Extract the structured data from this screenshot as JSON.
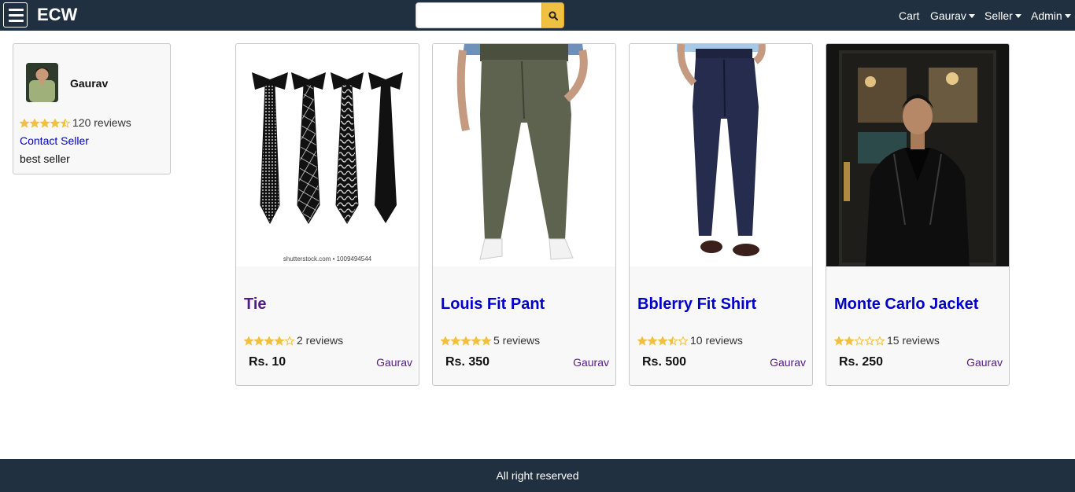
{
  "header": {
    "brand": "ECW",
    "search": {
      "value": "",
      "placeholder": ""
    },
    "nav": {
      "cart": "Cart",
      "user": "Gaurav",
      "seller": "Seller",
      "admin": "Admin"
    }
  },
  "seller": {
    "name": "Gaurav",
    "rating": 4.5,
    "reviews_text": "120 reviews",
    "contact_label": "Contact Seller",
    "description": "best seller"
  },
  "products": [
    {
      "name": "Tie",
      "rating": 4,
      "reviews_text": "2 reviews",
      "price": "Rs. 10",
      "seller": "Gaurav",
      "image": "tie-image",
      "watermark": "shutterstock.com • 1009494544"
    },
    {
      "name": "Louis Fit Pant",
      "rating": 5,
      "reviews_text": "5 reviews",
      "price": "Rs. 350",
      "seller": "Gaurav",
      "image": "olive-pant-image"
    },
    {
      "name": "Bblerry Fit Shirt",
      "rating": 3.5,
      "reviews_text": "10 reviews",
      "price": "Rs. 500",
      "seller": "Gaurav",
      "image": "navy-pant-image"
    },
    {
      "name": "Monte Carlo Jacket",
      "rating": 2,
      "reviews_text": "15 reviews",
      "price": "Rs. 250",
      "seller": "Gaurav",
      "image": "leather-jacket-image"
    }
  ],
  "footer": {
    "text": "All right reserved"
  },
  "colors": {
    "header_bg": "#203040",
    "accent": "#f0c040",
    "link": "#0000cc",
    "visited": "#551a8b",
    "star": "#f0c040"
  }
}
